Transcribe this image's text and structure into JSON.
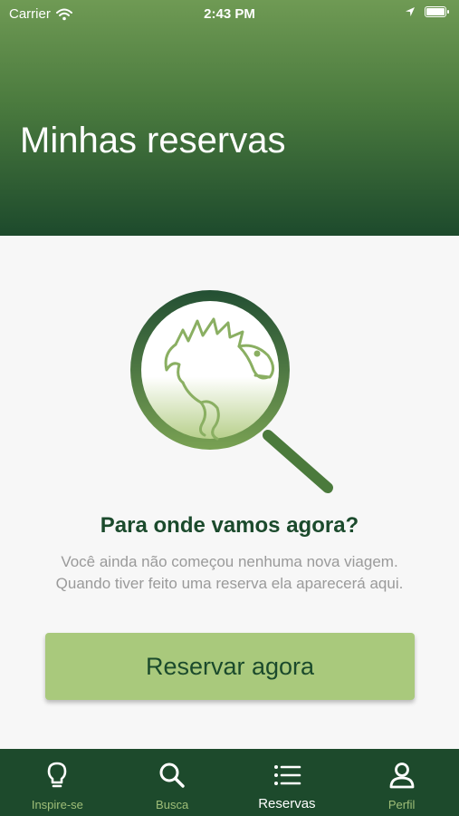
{
  "status_bar": {
    "carrier": "Carrier",
    "time": "2:43 PM"
  },
  "header": {
    "title": "Minhas reservas"
  },
  "empty_state": {
    "heading": "Para onde vamos agora?",
    "description": "Você ainda não começou nenhuma nova viagem. Quando tiver feito uma reserva ela aparecerá aqui.",
    "button_label": "Reservar agora"
  },
  "tabs": [
    {
      "label": "Inspire-se",
      "icon": "lightbulb-icon",
      "active": false
    },
    {
      "label": "Busca",
      "icon": "search-icon",
      "active": false
    },
    {
      "label": "Reservas",
      "icon": "list-icon",
      "active": true
    },
    {
      "label": "Perfil",
      "icon": "person-icon",
      "active": false
    }
  ],
  "colors": {
    "brand_dark": "#1d4a2c",
    "brand_light": "#a9c97c",
    "inactive_tab": "#9fbe78"
  }
}
